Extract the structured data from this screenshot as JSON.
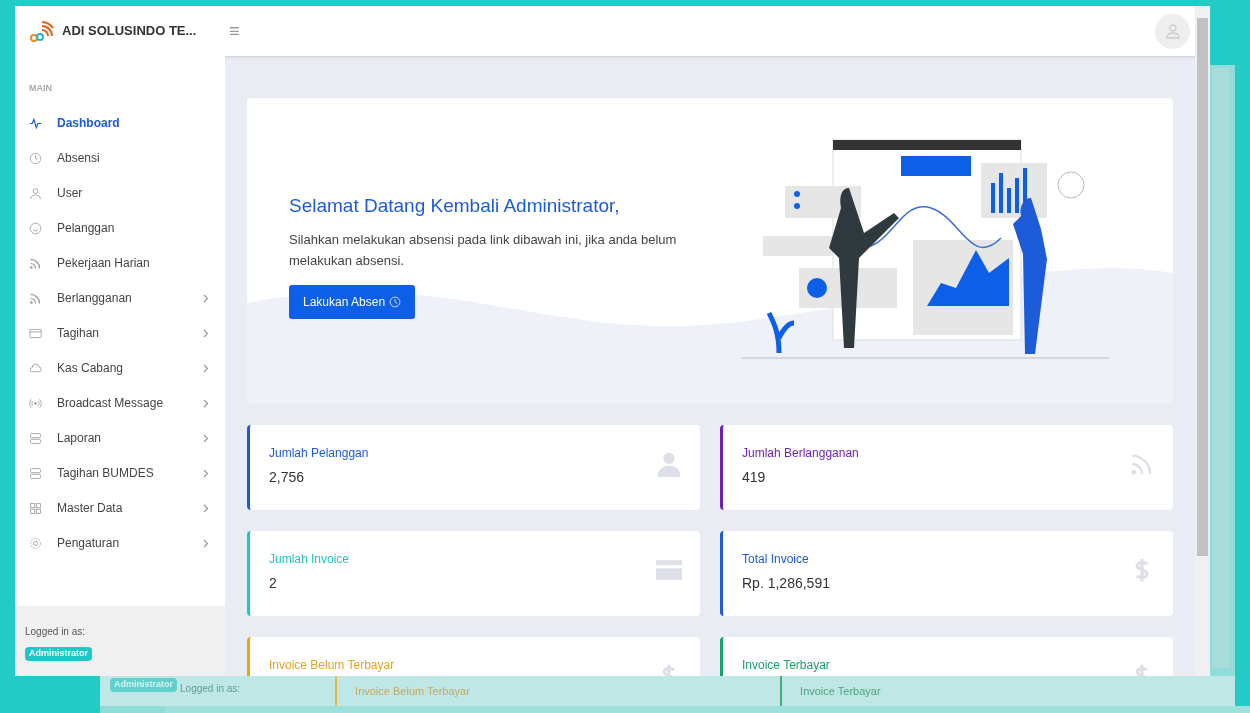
{
  "header": {
    "brand": "ADI SOLUSINDO TE...",
    "menu_glyph": "≡"
  },
  "sidebar": {
    "section": "MAIN",
    "items": [
      {
        "label": "Dashboard",
        "kind": "pulse",
        "selected": true,
        "expandable": false
      },
      {
        "label": "Absensi",
        "kind": "clock",
        "selected": false,
        "expandable": false
      },
      {
        "label": "User",
        "kind": "user",
        "selected": false,
        "expandable": false
      },
      {
        "label": "Pelanggan",
        "kind": "smile",
        "selected": false,
        "expandable": false
      },
      {
        "label": "Pekerjaan Harian",
        "kind": "rss",
        "selected": false,
        "expandable": false
      },
      {
        "label": "Berlangganan",
        "kind": "rss",
        "selected": false,
        "expandable": true
      },
      {
        "label": "Tagihan",
        "kind": "card",
        "selected": false,
        "expandable": true
      },
      {
        "label": "Kas Cabang",
        "kind": "cloud",
        "selected": false,
        "expandable": true
      },
      {
        "label": "Broadcast Message",
        "kind": "broadcast",
        "selected": false,
        "expandable": true
      },
      {
        "label": "Laporan",
        "kind": "server",
        "selected": false,
        "expandable": true
      },
      {
        "label": "Tagihan BUMDES",
        "kind": "server",
        "selected": false,
        "expandable": true
      },
      {
        "label": "Master Data",
        "kind": "grid",
        "selected": false,
        "expandable": true
      },
      {
        "label": "Pengaturan",
        "kind": "gear",
        "selected": false,
        "expandable": true
      }
    ],
    "footer": {
      "caption": "Logged in as:",
      "role": "Administrator"
    }
  },
  "welcome": {
    "title": "Selamat Datang Kembali Administrator,",
    "text": "Silahkan melakukan absensi pada link dibawah ini, jika anda belum melakukan absensi.",
    "button": "Lakukan Absen"
  },
  "stats": [
    {
      "label": "Jumlah Pelanggan",
      "value": "2,756",
      "color": "#1d5bd8",
      "kind": "user"
    },
    {
      "label": "Jumlah Berlangganan",
      "value": "419",
      "color": "#6f1fc0",
      "kind": "rss"
    },
    {
      "label": "Jumlah Invoice",
      "value": "2",
      "color": "#22c3c9",
      "kind": "card"
    },
    {
      "label": "Total Invoice",
      "value": "Rp. 1,286,591",
      "color": "#1d5bd8",
      "kind": "dollar"
    },
    {
      "label": "Invoice Belum Terbayar",
      "color": "#e8a317",
      "kind": "dollar"
    },
    {
      "label": "Invoice Terbayar",
      "color": "#16a36a",
      "kind": "dollar"
    }
  ],
  "ghost": {
    "caption": "Logged in as:",
    "role": "Administrator",
    "labels": [
      "Invoice Belum Terbayar",
      "Invoice Terbayar"
    ]
  }
}
